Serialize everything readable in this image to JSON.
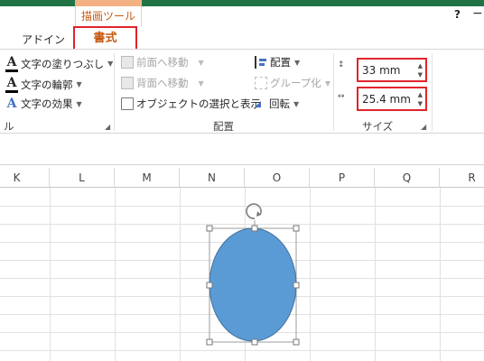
{
  "context_tab": {
    "title": "描画ツール"
  },
  "window": {
    "help": "?",
    "minimize": "−"
  },
  "tabs": {
    "addin": "アドイン",
    "format": "書式"
  },
  "ribbon": {
    "wordart": {
      "fill": "文字の塗りつぶし",
      "outline": "文字の輪郭",
      "effect": "文字の効果",
      "group_label": "ル"
    },
    "arrange": {
      "bring_forward": "前面へ移動",
      "send_backward": "背面へ移動",
      "selection_pane": "オブジェクトの選択と表示",
      "align": "配置",
      "group": "グループ化",
      "rotate": "回転",
      "group_label": "配置"
    },
    "size": {
      "height": "33 mm",
      "width": "25.4 mm",
      "group_label": "サイズ"
    }
  },
  "columns": [
    "K",
    "L",
    "M",
    "N",
    "O",
    "P",
    "Q",
    "R"
  ],
  "colors": {
    "accent": "#217346",
    "highlight": "#e0242b",
    "shape_fill": "#5b9bd5",
    "shape_stroke": "#41719c",
    "context": "#c55a11"
  }
}
